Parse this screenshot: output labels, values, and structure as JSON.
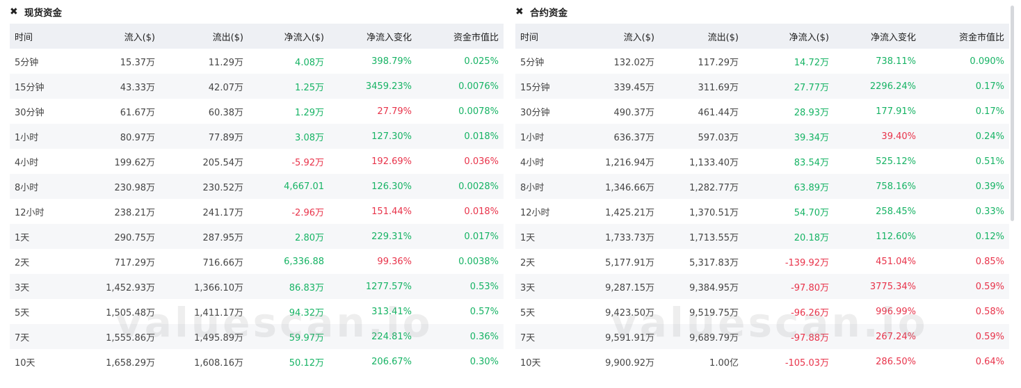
{
  "spot": {
    "title": "现货资金",
    "headers": [
      "时间",
      "流入($)",
      "流出($)",
      "净流入($)",
      "净流入变化",
      "资金市值比"
    ],
    "rows": [
      {
        "time": "5分钟",
        "inflow": "15.37万",
        "outflow": "11.29万",
        "net": "4.08万",
        "change": "398.79%",
        "ratio": "0.025%",
        "net_sign": "pos",
        "change_sign": "pos",
        "ratio_sign": "pos"
      },
      {
        "time": "15分钟",
        "inflow": "43.33万",
        "outflow": "42.07万",
        "net": "1.25万",
        "change": "3459.23%",
        "ratio": "0.0076%",
        "net_sign": "pos",
        "change_sign": "pos",
        "ratio_sign": "pos"
      },
      {
        "time": "30分钟",
        "inflow": "61.67万",
        "outflow": "60.38万",
        "net": "1.29万",
        "change": "27.79%",
        "ratio": "0.0078%",
        "net_sign": "pos",
        "change_sign": "neg",
        "ratio_sign": "pos"
      },
      {
        "time": "1小时",
        "inflow": "80.97万",
        "outflow": "77.89万",
        "net": "3.08万",
        "change": "127.30%",
        "ratio": "0.018%",
        "net_sign": "pos",
        "change_sign": "pos",
        "ratio_sign": "pos"
      },
      {
        "time": "4小时",
        "inflow": "199.62万",
        "outflow": "205.54万",
        "net": "-5.92万",
        "change": "192.69%",
        "ratio": "0.036%",
        "net_sign": "neg",
        "change_sign": "neg",
        "ratio_sign": "neg"
      },
      {
        "time": "8小时",
        "inflow": "230.98万",
        "outflow": "230.52万",
        "net": "4,667.01",
        "change": "126.30%",
        "ratio": "0.0028%",
        "net_sign": "pos",
        "change_sign": "pos",
        "ratio_sign": "pos"
      },
      {
        "time": "12小时",
        "inflow": "238.21万",
        "outflow": "241.17万",
        "net": "-2.96万",
        "change": "151.44%",
        "ratio": "0.018%",
        "net_sign": "neg",
        "change_sign": "neg",
        "ratio_sign": "neg"
      },
      {
        "time": "1天",
        "inflow": "290.75万",
        "outflow": "287.95万",
        "net": "2.80万",
        "change": "229.31%",
        "ratio": "0.017%",
        "net_sign": "pos",
        "change_sign": "pos",
        "ratio_sign": "pos"
      },
      {
        "time": "2天",
        "inflow": "717.29万",
        "outflow": "716.66万",
        "net": "6,336.88",
        "change": "99.36%",
        "ratio": "0.0038%",
        "net_sign": "pos",
        "change_sign": "neg",
        "ratio_sign": "pos"
      },
      {
        "time": "3天",
        "inflow": "1,452.93万",
        "outflow": "1,366.10万",
        "net": "86.83万",
        "change": "1277.57%",
        "ratio": "0.53%",
        "net_sign": "pos",
        "change_sign": "pos",
        "ratio_sign": "pos"
      },
      {
        "time": "5天",
        "inflow": "1,505.48万",
        "outflow": "1,411.17万",
        "net": "94.32万",
        "change": "313.41%",
        "ratio": "0.57%",
        "net_sign": "pos",
        "change_sign": "pos",
        "ratio_sign": "pos"
      },
      {
        "time": "7天",
        "inflow": "1,555.86万",
        "outflow": "1,495.89万",
        "net": "59.97万",
        "change": "224.81%",
        "ratio": "0.36%",
        "net_sign": "pos",
        "change_sign": "pos",
        "ratio_sign": "pos"
      },
      {
        "time": "10天",
        "inflow": "1,658.29万",
        "outflow": "1,608.16万",
        "net": "50.12万",
        "change": "206.67%",
        "ratio": "0.30%",
        "net_sign": "pos",
        "change_sign": "pos",
        "ratio_sign": "pos"
      }
    ]
  },
  "futures": {
    "title": "合约资金",
    "headers": [
      "时间",
      "流入($)",
      "流出($)",
      "净流入($)",
      "净流入变化",
      "资金市值比"
    ],
    "rows": [
      {
        "time": "5分钟",
        "inflow": "132.02万",
        "outflow": "117.29万",
        "net": "14.72万",
        "change": "738.11%",
        "ratio": "0.090%",
        "net_sign": "pos",
        "change_sign": "pos",
        "ratio_sign": "pos"
      },
      {
        "time": "15分钟",
        "inflow": "339.45万",
        "outflow": "311.69万",
        "net": "27.77万",
        "change": "2296.24%",
        "ratio": "0.17%",
        "net_sign": "pos",
        "change_sign": "pos",
        "ratio_sign": "pos"
      },
      {
        "time": "30分钟",
        "inflow": "490.37万",
        "outflow": "461.44万",
        "net": "28.93万",
        "change": "177.91%",
        "ratio": "0.17%",
        "net_sign": "pos",
        "change_sign": "pos",
        "ratio_sign": "pos"
      },
      {
        "time": "1小时",
        "inflow": "636.37万",
        "outflow": "597.03万",
        "net": "39.34万",
        "change": "39.40%",
        "ratio": "0.24%",
        "net_sign": "pos",
        "change_sign": "neg",
        "ratio_sign": "pos"
      },
      {
        "time": "4小时",
        "inflow": "1,216.94万",
        "outflow": "1,133.40万",
        "net": "83.54万",
        "change": "525.12%",
        "ratio": "0.51%",
        "net_sign": "pos",
        "change_sign": "pos",
        "ratio_sign": "pos"
      },
      {
        "time": "8小时",
        "inflow": "1,346.66万",
        "outflow": "1,282.77万",
        "net": "63.89万",
        "change": "758.16%",
        "ratio": "0.39%",
        "net_sign": "pos",
        "change_sign": "pos",
        "ratio_sign": "pos"
      },
      {
        "time": "12小时",
        "inflow": "1,425.21万",
        "outflow": "1,370.51万",
        "net": "54.70万",
        "change": "258.45%",
        "ratio": "0.33%",
        "net_sign": "pos",
        "change_sign": "pos",
        "ratio_sign": "pos"
      },
      {
        "time": "1天",
        "inflow": "1,733.73万",
        "outflow": "1,713.55万",
        "net": "20.18万",
        "change": "112.60%",
        "ratio": "0.12%",
        "net_sign": "pos",
        "change_sign": "pos",
        "ratio_sign": "pos"
      },
      {
        "time": "2天",
        "inflow": "5,177.91万",
        "outflow": "5,317.83万",
        "net": "-139.92万",
        "change": "451.04%",
        "ratio": "0.85%",
        "net_sign": "neg",
        "change_sign": "neg",
        "ratio_sign": "neg"
      },
      {
        "time": "3天",
        "inflow": "9,287.15万",
        "outflow": "9,384.95万",
        "net": "-97.80万",
        "change": "3775.34%",
        "ratio": "0.59%",
        "net_sign": "neg",
        "change_sign": "neg",
        "ratio_sign": "neg"
      },
      {
        "time": "5天",
        "inflow": "9,423.50万",
        "outflow": "9,519.75万",
        "net": "-96.26万",
        "change": "996.99%",
        "ratio": "0.58%",
        "net_sign": "neg",
        "change_sign": "neg",
        "ratio_sign": "neg"
      },
      {
        "time": "7天",
        "inflow": "9,591.91万",
        "outflow": "9,689.79万",
        "net": "-97.88万",
        "change": "267.24%",
        "ratio": "0.59%",
        "net_sign": "neg",
        "change_sign": "neg",
        "ratio_sign": "neg"
      },
      {
        "time": "10天",
        "inflow": "9,900.92万",
        "outflow": "1.00亿",
        "net": "-105.03万",
        "change": "286.50%",
        "ratio": "0.64%",
        "net_sign": "neg",
        "change_sign": "neg",
        "ratio_sign": "neg"
      }
    ]
  },
  "watermark": "valuescan.io",
  "icons": {
    "close": "close-icon"
  },
  "colors": {
    "positive": "#16b364",
    "negative": "#e8334a",
    "header_bg": "#eef0f4",
    "stripe_bg": "#f6f7f9"
  }
}
